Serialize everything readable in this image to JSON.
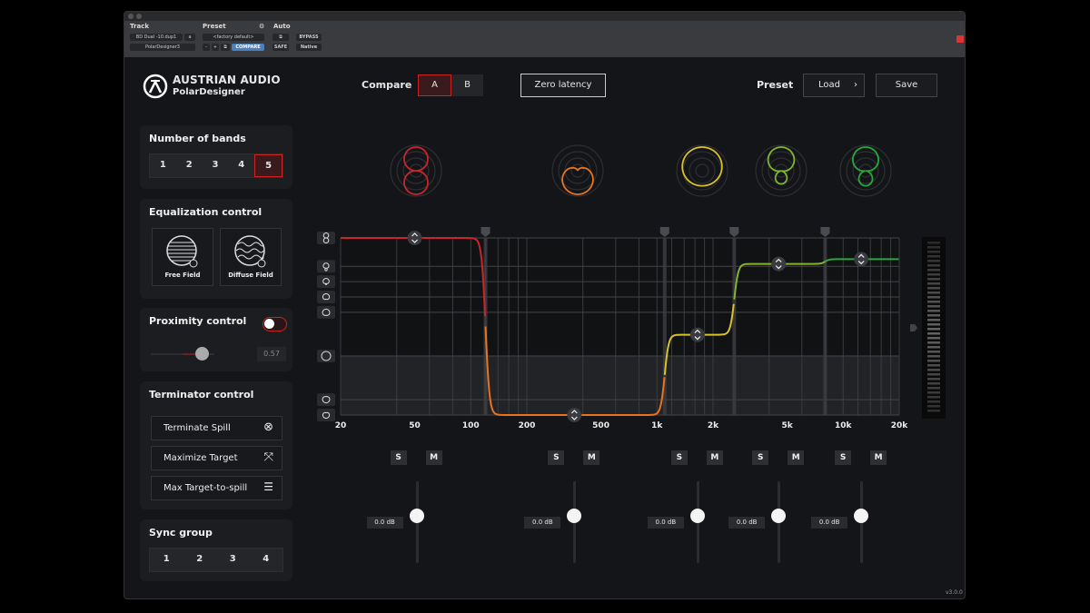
{
  "host": {
    "track_label": "Track",
    "preset_label": "Preset",
    "auto_label": "Auto",
    "track_name": "BD Dual -10.dup1",
    "track_slot": "a",
    "plugin_name": "PolarDesigner3",
    "preset_value": "<factory default>",
    "compare": "COMPARE",
    "bypass": "BYPASS",
    "safe": "SAFE",
    "native": "Native",
    "minus": "-",
    "plus": "+"
  },
  "brand": {
    "name": "AUSTRIAN AUDIO",
    "product": "PolarDesigner"
  },
  "header": {
    "compare_label": "Compare",
    "ab": [
      "A",
      "B"
    ],
    "ab_selected": "A",
    "zero_latency": "Zero latency",
    "preset_label": "Preset",
    "load": "Load",
    "save": "Save"
  },
  "bands_panel": {
    "title": "Number of bands",
    "options": [
      "1",
      "2",
      "3",
      "4",
      "5"
    ],
    "selected": "5"
  },
  "eq_panel": {
    "title": "Equalization control",
    "free": "Free Field",
    "diffuse": "Diffuse Field"
  },
  "proximity": {
    "title": "Proximity control",
    "enabled": true,
    "value": "0.57",
    "value_fraction": 0.57
  },
  "terminator": {
    "title": "Terminator control",
    "items": [
      "Terminate Spill",
      "Maximize Target",
      "Max Target-to-spill"
    ]
  },
  "sync": {
    "title": "Sync group",
    "options": [
      "1",
      "2",
      "3",
      "4"
    ]
  },
  "version": "v3.0.0",
  "colors": {
    "accent": "#c8262c",
    "band": [
      "#c8262c",
      "#e8731f",
      "#d8c22a",
      "#7fb52f",
      "#2aa73a"
    ]
  },
  "chart_data": {
    "type": "line",
    "x_axis": {
      "scale": "log",
      "range": [
        20,
        20000
      ],
      "ticks": [
        "20",
        "50",
        "100",
        "200",
        "500",
        "1k",
        "2k",
        "5k",
        "10k",
        "20k"
      ],
      "tick_values": [
        20,
        50,
        100,
        200,
        500,
        1000,
        2000,
        5000,
        10000,
        20000
      ]
    },
    "y_axis": {
      "meaning": "polar pattern",
      "range": [
        0,
        1.5
      ],
      "levels": [
        {
          "icon": "figure-8",
          "v": 0
        },
        {
          "icon": "hypercardioid",
          "v": 0.24
        },
        {
          "icon": "supercardioid",
          "v": 0.37
        },
        {
          "icon": "cardioid",
          "v": 0.5
        },
        {
          "icon": "wide-cardioid",
          "v": 0.63
        },
        {
          "icon": "omni",
          "v": 1
        },
        {
          "icon": "reverse-wide-cardioid",
          "v": 1.37
        },
        {
          "icon": "reverse-cardioid",
          "v": 1.5
        }
      ]
    },
    "crossovers_hz": [
      120,
      1100,
      2600,
      8000
    ],
    "bands": [
      {
        "pattern": 0,
        "handle_hz": 50,
        "gain": "0.0 dB",
        "s": "S",
        "m": "M"
      },
      {
        "pattern": 1.5,
        "handle_hz": 360,
        "gain": "0.0 dB",
        "s": "S",
        "m": "M"
      },
      {
        "pattern": 0.82,
        "handle_hz": 1650,
        "gain": "0.0 dB",
        "s": "S",
        "m": "M"
      },
      {
        "pattern": 0.22,
        "handle_hz": 4500,
        "gain": "0.0 dB",
        "s": "S",
        "m": "M"
      },
      {
        "pattern": 0.18,
        "handle_hz": 12500,
        "gain": "0.0 dB",
        "s": "S",
        "m": "M"
      }
    ],
    "grid": true
  }
}
